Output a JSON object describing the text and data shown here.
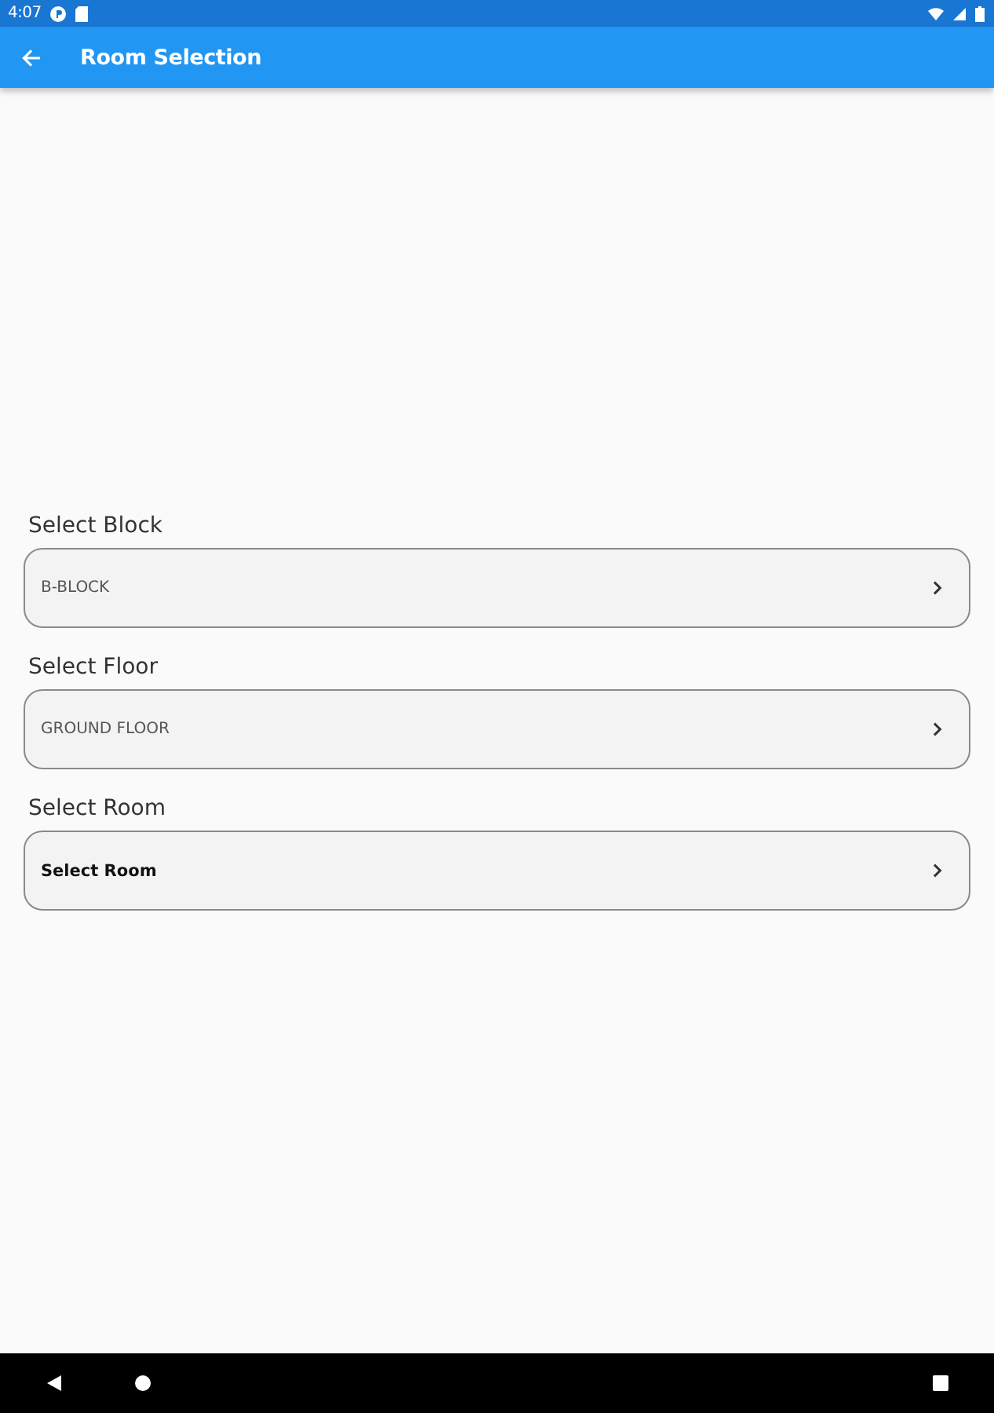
{
  "status_bar": {
    "time": "4:07"
  },
  "app_bar": {
    "title": "Room Selection"
  },
  "fields": [
    {
      "label": "Select Block",
      "value": "B-BLOCK"
    },
    {
      "label": "Select Floor",
      "value": "GROUND FLOOR"
    },
    {
      "label": "Select Room",
      "placeholder": "Select Room"
    }
  ]
}
